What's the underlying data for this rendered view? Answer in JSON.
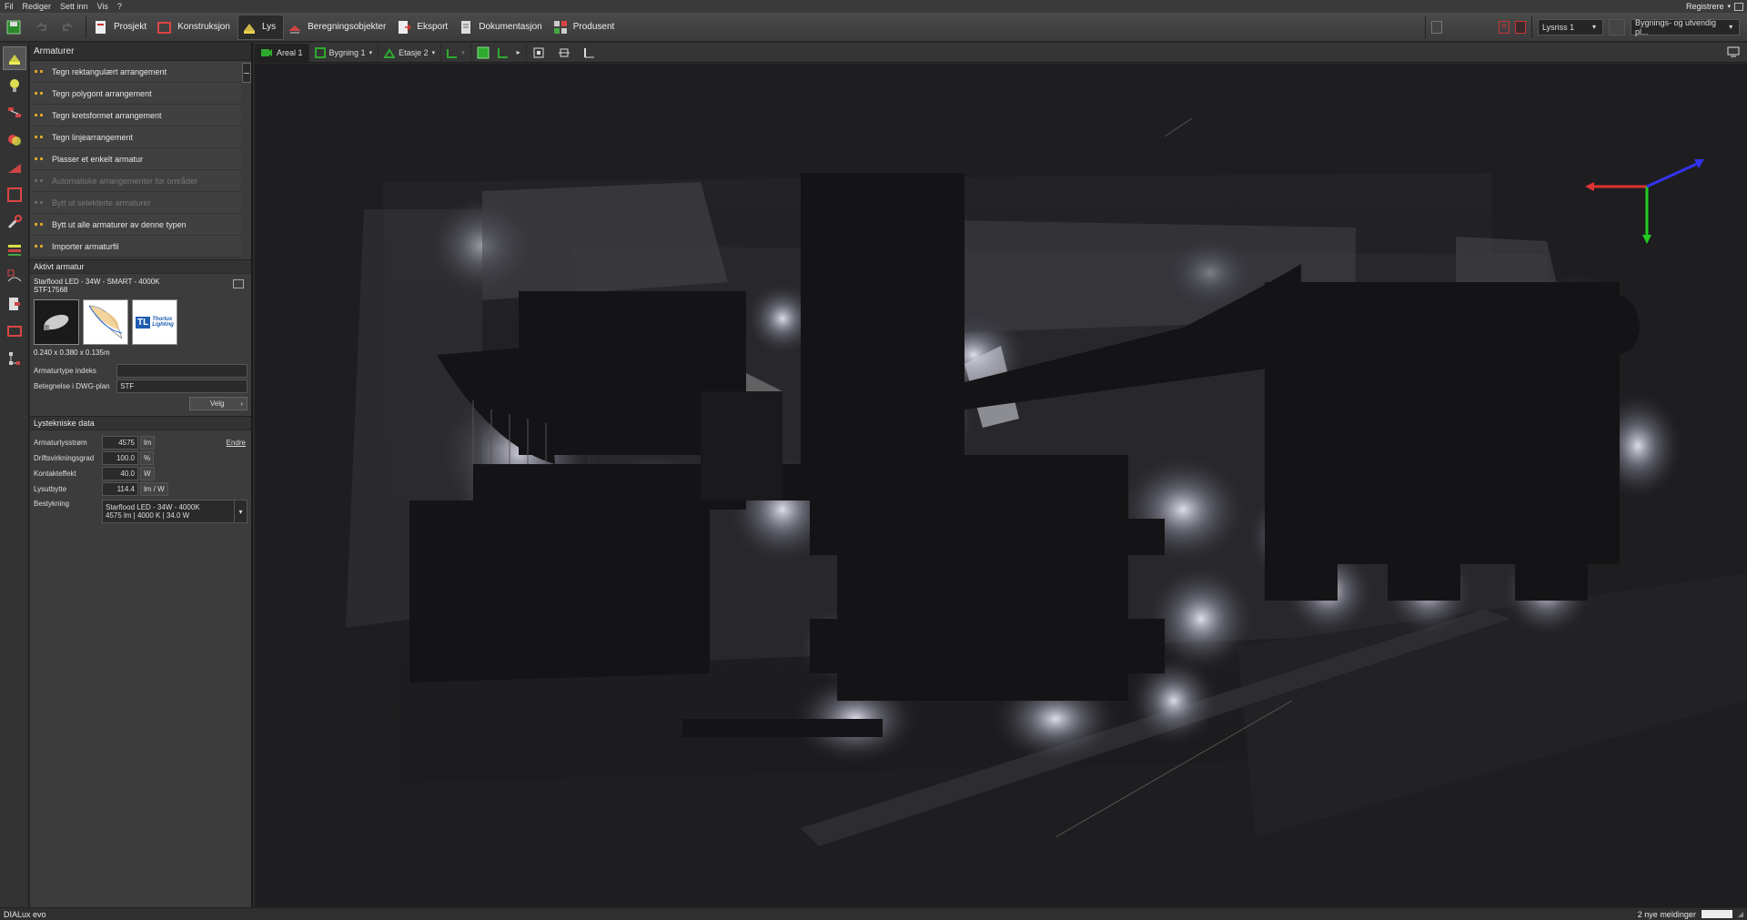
{
  "menu": {
    "items": [
      "Fil",
      "Rediger",
      "Sett inn",
      "Vis",
      "?"
    ],
    "register": "Registrere"
  },
  "toolbar": {
    "tabs": [
      {
        "label": "Prosjekt"
      },
      {
        "label": "Konstruksjon"
      },
      {
        "label": "Lys"
      },
      {
        "label": "Beregningsobjekter"
      },
      {
        "label": "Eksport"
      },
      {
        "label": "Dokumentasjon"
      },
      {
        "label": "Produsent"
      }
    ],
    "scene_select": "Lysriss 1",
    "view_select": "Bygnings- og utvendig pl..."
  },
  "panel": {
    "title": "Armaturer",
    "commands": [
      {
        "label": "Tegn rektangulært arrangement",
        "enabled": true
      },
      {
        "label": "Tegn polygont arrangement",
        "enabled": true
      },
      {
        "label": "Tegn kretsformet arrangement",
        "enabled": true
      },
      {
        "label": "Tegn linjearrangement",
        "enabled": true
      },
      {
        "label": "Plasser et enkelt armatur",
        "enabled": true
      },
      {
        "label": "Automatiske arrangementer for områder",
        "enabled": false
      },
      {
        "label": "Bytt ut selekterte armaturer",
        "enabled": false
      },
      {
        "label": "Bytt ut alle armaturer av denne typen",
        "enabled": true
      },
      {
        "label": "Importer armaturfil",
        "enabled": true
      }
    ],
    "active": {
      "title": "Aktivt armatur",
      "name": "Starflood LED - 34W - SMART - 4000K",
      "code": "STF17568",
      "dims": "0.240 x 0.380 x 0.135m",
      "brand": "Thorlux Lighting",
      "type_index_label": "Armaturtype indeks",
      "type_index_value": "",
      "dwg_label": "Betegnelse i DWG-plan",
      "dwg_value": "STF",
      "choose_button": "Velg"
    },
    "photometric": {
      "title": "Lystekniske data",
      "change_link": "Endre",
      "rows": [
        {
          "label": "Armaturlysstrøm",
          "value": "4575",
          "unit": "lm"
        },
        {
          "label": "Driftsvirkningsgrad",
          "value": "100.0",
          "unit": "%"
        },
        {
          "label": "Kontakteffekt",
          "value": "40.0",
          "unit": "W"
        },
        {
          "label": "Lysutbytte",
          "value": "114.4",
          "unit": "lm / W"
        }
      ],
      "equip_label": "Bestykning",
      "equip_line1": "Starflood LED - 34W - 4000K",
      "equip_line2": "4575 lm  |  4000 K  |  34.0 W"
    }
  },
  "viewbar": {
    "area": "Areal 1",
    "building": "Bygning 1",
    "floor": "Etasje 2"
  },
  "status": {
    "brand": "DIALux evo",
    "messages": "2 nye meldinger"
  },
  "colors": {
    "bg": "#2b2b2b",
    "accent_green": "#2eaa2e",
    "axis_red": "#d33",
    "axis_green": "#2c2",
    "axis_blue": "#33e"
  }
}
